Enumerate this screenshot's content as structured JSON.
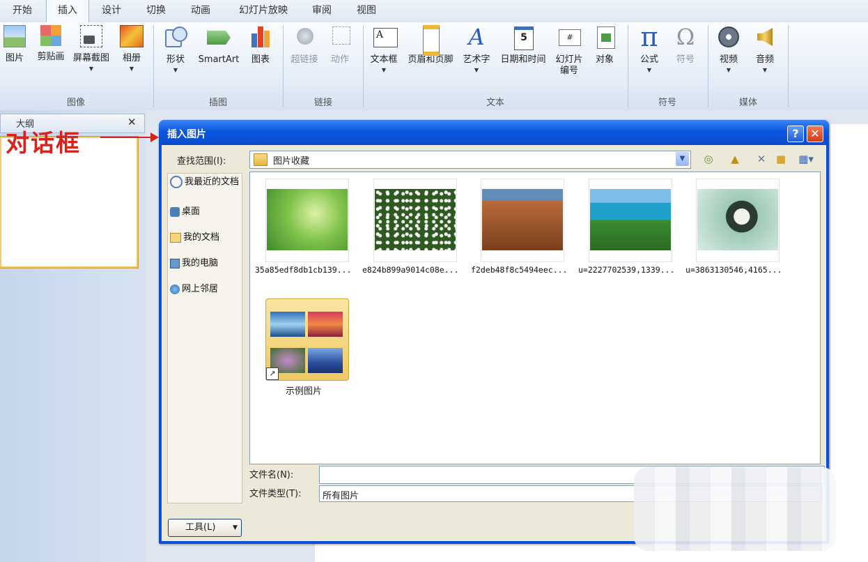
{
  "ribbon": {
    "tabs": [
      "开始",
      "插入",
      "设计",
      "切换",
      "动画",
      "幻灯片放映",
      "审阅",
      "视图"
    ],
    "active_tab": "插入",
    "groups": [
      {
        "label": "图像",
        "buttons": [
          "图片",
          "剪贴画",
          "屏幕截图",
          "相册"
        ]
      },
      {
        "label": "插图",
        "buttons": [
          "形状",
          "SmartArt",
          "图表"
        ]
      },
      {
        "label": "链接",
        "buttons": [
          "超链接",
          "动作"
        ]
      },
      {
        "label": "文本",
        "buttons": [
          "文本框",
          "页眉和页脚",
          "艺术字",
          "日期和时间",
          "幻灯片\n编号",
          "对象"
        ]
      },
      {
        "label": "符号",
        "buttons": [
          "公式",
          "符号"
        ]
      },
      {
        "label": "媒体",
        "buttons": [
          "视频",
          "音频"
        ]
      }
    ]
  },
  "left_pane": {
    "tab": "大纲",
    "close": "✕"
  },
  "annotation": {
    "text": "对话框"
  },
  "dialog": {
    "title": "插入图片",
    "help": "?",
    "close": "✕",
    "look_in_label": "查找范围(I):",
    "look_in_value": "图片收藏",
    "places": [
      "我最近的文档",
      "桌面",
      "我的文档",
      "我的电脑",
      "网上邻居"
    ],
    "files": [
      {
        "name": "35a85edf8db1cb139..."
      },
      {
        "name": "e824b899a9014c08e..."
      },
      {
        "name": "f2deb48f8c5494eec..."
      },
      {
        "name": "u=2227702539,1339..."
      },
      {
        "name": "u=3863130546,4165..."
      }
    ],
    "folder": {
      "name": "示例图片"
    },
    "filename_label": "文件名(N):",
    "filename_value": "",
    "filetype_label": "文件类型(T):",
    "filetype_value": "所有图片",
    "tools_label": "工具(L)"
  }
}
